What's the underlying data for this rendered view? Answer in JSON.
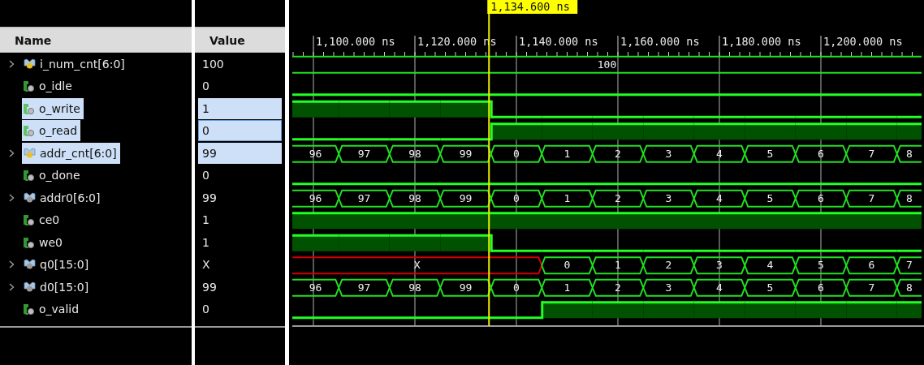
{
  "columns": {
    "name": "Name",
    "value": "Value"
  },
  "cursor": {
    "label": "1,134.600 ns"
  },
  "ruler": {
    "labels": [
      "1,100.000 ns",
      "1,120.000 ns",
      "1,140.000 ns",
      "1,160.000 ns",
      "1,180.000 ns",
      "1,200.000 ns"
    ]
  },
  "signals": [
    {
      "name": "i_num_cnt[6:0]",
      "value": "100",
      "kind": "bus",
      "color": "#e8c020",
      "expandable": true,
      "selected": false,
      "focused": false,
      "segments": [
        {
          "label": "100",
          "unknown": false
        }
      ]
    },
    {
      "name": "o_idle",
      "value": "0",
      "kind": "bit",
      "expandable": false,
      "selected": false,
      "focused": false,
      "high": [
        false
      ]
    },
    {
      "name": "o_write",
      "value": "1",
      "kind": "bit",
      "expandable": false,
      "selected": true,
      "focused": false,
      "high": [
        true,
        true,
        true,
        true,
        false,
        false,
        false,
        false,
        false,
        false,
        false,
        false,
        false
      ]
    },
    {
      "name": "o_read",
      "value": "0",
      "kind": "bit",
      "expandable": false,
      "selected": true,
      "focused": true,
      "high": [
        false,
        false,
        false,
        false,
        true,
        true,
        true,
        true,
        true,
        true,
        true,
        true,
        true
      ]
    },
    {
      "name": "addr_cnt[6:0]",
      "value": "99",
      "kind": "bus",
      "color": "#e8c020",
      "expandable": true,
      "selected": true,
      "focused": false,
      "segments": [
        {
          "label": "96",
          "unknown": false
        },
        {
          "label": "97",
          "unknown": false
        },
        {
          "label": "98",
          "unknown": false
        },
        {
          "label": "99",
          "unknown": false
        },
        {
          "label": "0",
          "unknown": false
        },
        {
          "label": "1",
          "unknown": false
        },
        {
          "label": "2",
          "unknown": false
        },
        {
          "label": "3",
          "unknown": false
        },
        {
          "label": "4",
          "unknown": false
        },
        {
          "label": "5",
          "unknown": false
        },
        {
          "label": "6",
          "unknown": false
        },
        {
          "label": "7",
          "unknown": false
        },
        {
          "label": "8",
          "unknown": false
        }
      ]
    },
    {
      "name": "o_done",
      "value": "0",
      "kind": "bit",
      "expandable": false,
      "selected": false,
      "focused": false,
      "high": [
        false
      ]
    },
    {
      "name": "addr0[6:0]",
      "value": "99",
      "kind": "bus",
      "color": "#9a9a9a",
      "expandable": true,
      "selected": false,
      "focused": false,
      "segments": [
        {
          "label": "96",
          "unknown": false
        },
        {
          "label": "97",
          "unknown": false
        },
        {
          "label": "98",
          "unknown": false
        },
        {
          "label": "99",
          "unknown": false
        },
        {
          "label": "0",
          "unknown": false
        },
        {
          "label": "1",
          "unknown": false
        },
        {
          "label": "2",
          "unknown": false
        },
        {
          "label": "3",
          "unknown": false
        },
        {
          "label": "4",
          "unknown": false
        },
        {
          "label": "5",
          "unknown": false
        },
        {
          "label": "6",
          "unknown": false
        },
        {
          "label": "7",
          "unknown": false
        },
        {
          "label": "8",
          "unknown": false
        }
      ]
    },
    {
      "name": "ce0",
      "value": "1",
      "kind": "bit",
      "expandable": false,
      "selected": false,
      "focused": false,
      "high": [
        true
      ]
    },
    {
      "name": "we0",
      "value": "1",
      "kind": "bit",
      "expandable": false,
      "selected": false,
      "focused": false,
      "high": [
        true,
        true,
        true,
        true,
        false,
        false,
        false,
        false,
        false,
        false,
        false,
        false,
        false
      ]
    },
    {
      "name": "q0[15:0]",
      "value": "X",
      "kind": "bus",
      "color": "#9a9a9a",
      "expandable": true,
      "selected": false,
      "focused": false,
      "segments": [
        {
          "label": "X",
          "unknown": true
        },
        {
          "label": "0",
          "unknown": false
        },
        {
          "label": "1",
          "unknown": false
        },
        {
          "label": "2",
          "unknown": false
        },
        {
          "label": "3",
          "unknown": false
        },
        {
          "label": "4",
          "unknown": false
        },
        {
          "label": "5",
          "unknown": false
        },
        {
          "label": "6",
          "unknown": false
        },
        {
          "label": "7",
          "unknown": false
        }
      ]
    },
    {
      "name": "d0[15:0]",
      "value": "99",
      "kind": "bus",
      "color": "#9a9a9a",
      "expandable": true,
      "selected": false,
      "focused": false,
      "segments": [
        {
          "label": "96",
          "unknown": false
        },
        {
          "label": "97",
          "unknown": false
        },
        {
          "label": "98",
          "unknown": false
        },
        {
          "label": "99",
          "unknown": false
        },
        {
          "label": "0",
          "unknown": false
        },
        {
          "label": "1",
          "unknown": false
        },
        {
          "label": "2",
          "unknown": false
        },
        {
          "label": "3",
          "unknown": false
        },
        {
          "label": "4",
          "unknown": false
        },
        {
          "label": "5",
          "unknown": false
        },
        {
          "label": "6",
          "unknown": false
        },
        {
          "label": "7",
          "unknown": false
        },
        {
          "label": "8",
          "unknown": false
        }
      ]
    },
    {
      "name": "o_valid",
      "value": "0",
      "kind": "bit",
      "expandable": false,
      "selected": false,
      "focused": false,
      "high": [
        false,
        true,
        true,
        true,
        true,
        true,
        true,
        true,
        true
      ]
    }
  ]
}
